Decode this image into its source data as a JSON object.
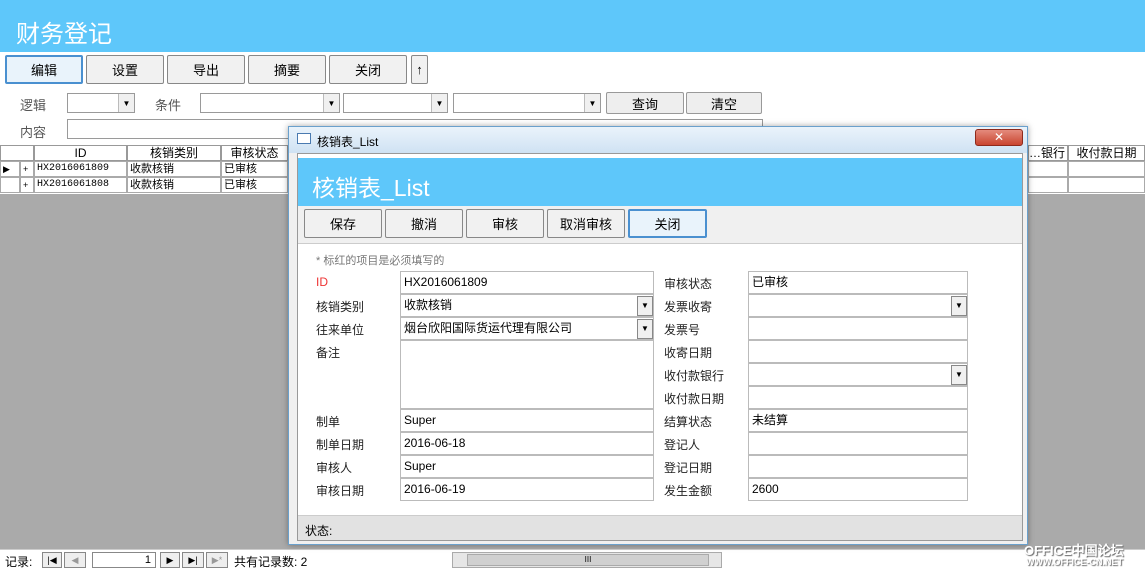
{
  "app": {
    "title": "财务登记"
  },
  "toolbar": {
    "edit": "编辑",
    "settings": "设置",
    "export": "导出",
    "summary": "摘要",
    "close": "关闭",
    "up_arrow": "↑"
  },
  "filter": {
    "logic_label": "逻辑",
    "condition_label": "条件",
    "query": "查询",
    "clear": "清空",
    "content_label": "内容"
  },
  "grid": {
    "headers": [
      "ID",
      "核销类别",
      "审核状态",
      "…银行",
      "收付款日期"
    ],
    "rows": [
      {
        "id": "HX2016061809",
        "type": "收款核销",
        "status": "已审核"
      },
      {
        "id": "HX2016061808",
        "type": "收款核销",
        "status": "已审核"
      }
    ]
  },
  "statusbar": {
    "record_label": "记录:",
    "current": "1",
    "total_text": "共有记录数: 2",
    "scroll_grip": "III"
  },
  "dialog": {
    "window_title": "核销表_List",
    "header_title": "核销表_List",
    "buttons": {
      "save": "保存",
      "undo": "撤消",
      "approve": "审核",
      "unapprove": "取消审核",
      "close": "关闭"
    },
    "hint": "* 标红的项目是必须填写的",
    "fields": {
      "id_label": "ID",
      "id_value": "HX2016061809",
      "type_label": "核销类别",
      "type_value": "收款核销",
      "partner_label": "往来单位",
      "partner_value": "烟台欣阳国际货运代理有限公司",
      "notes_label": "备注",
      "notes_value": "",
      "maker_label": "制单",
      "maker_value": "Super",
      "make_date_label": "制单日期",
      "make_date_value": "2016-06-18",
      "reviewer_label": "审核人",
      "reviewer_value": "Super",
      "review_date_label": "审核日期",
      "review_date_value": "2016-06-19",
      "review_status_label": "审核状态",
      "review_status_value": "已审核",
      "invoice_sent_label": "发票收寄",
      "invoice_sent_value": "",
      "invoice_no_label": "发票号",
      "invoice_no_value": "",
      "sent_date_label": "收寄日期",
      "sent_date_value": "",
      "bank_label": "收付款银行",
      "bank_value": "",
      "pay_date_label": "收付款日期",
      "pay_date_value": "",
      "settle_status_label": "结算状态",
      "settle_status_value": "未结算",
      "registrar_label": "登记人",
      "registrar_value": "",
      "reg_date_label": "登记日期",
      "reg_date_value": "",
      "amount_label": "发生金额",
      "amount_value": "2600"
    },
    "status_label": "状态:"
  },
  "watermark": {
    "line1": "OFFICE中国论坛",
    "line2": "WWW.OFFICE-CN.NET"
  }
}
